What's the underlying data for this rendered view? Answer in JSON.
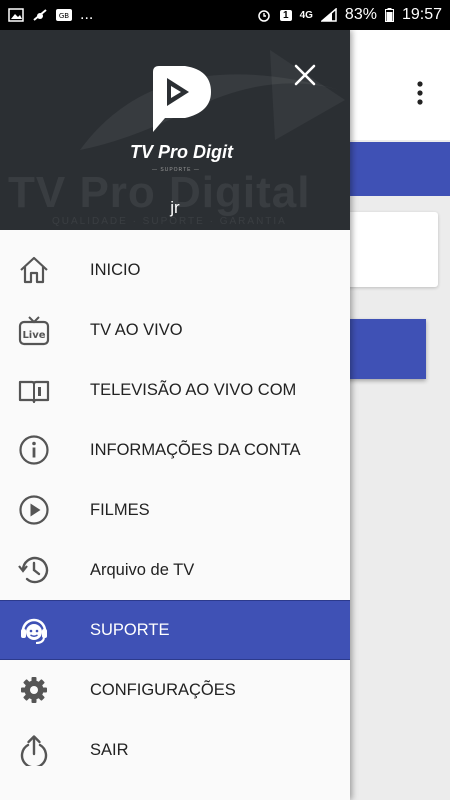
{
  "status_bar": {
    "left_dots": "...",
    "notif_badge": "1",
    "network": "4G",
    "battery": "83%",
    "time": "19:57"
  },
  "header": {
    "brand": "TV Pro Digit",
    "brand_sub": "— SUPORTE —",
    "watermark": "TV Pro Digital",
    "watermark_sub": "QUALIDADE · SUPORTE · GARANTIA",
    "username": "jr"
  },
  "menu": {
    "items": [
      {
        "label": "INICIO",
        "icon": "home-icon"
      },
      {
        "label": "TV AO VIVO",
        "icon": "live-tv-icon"
      },
      {
        "label": "TELEVISÃO AO VIVO COM",
        "icon": "book-icon"
      },
      {
        "label": "INFORMAÇÕES DA CONTA",
        "icon": "info-icon"
      },
      {
        "label": "FILMES",
        "icon": "play-circle-icon"
      },
      {
        "label": "Arquivo de TV",
        "icon": "history-icon"
      },
      {
        "label": "SUPORTE",
        "icon": "support-agent-icon",
        "active": true
      },
      {
        "label": "CONFIGURAÇÕES",
        "icon": "gear-icon"
      },
      {
        "label": "SAIR",
        "icon": "logout-icon"
      }
    ]
  },
  "colors": {
    "accent": "#3f51b5",
    "header_bg": "#2b2f33",
    "drawer_bg": "#fafafa"
  }
}
